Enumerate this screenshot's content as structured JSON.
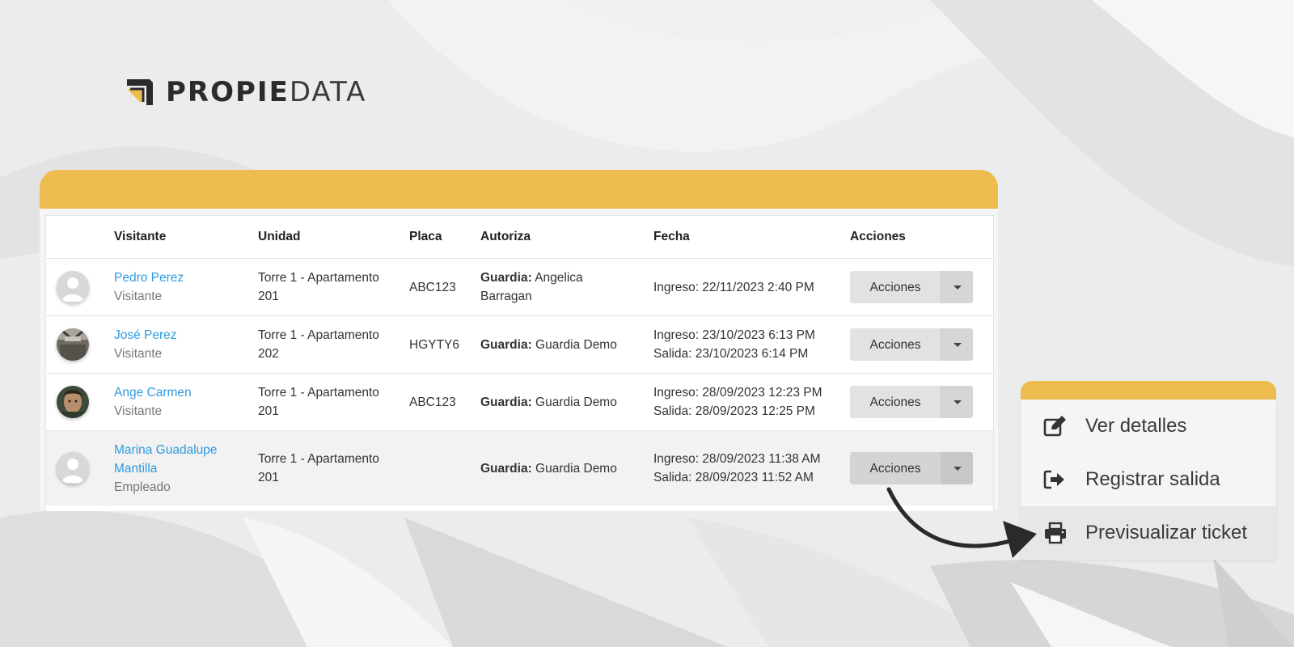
{
  "brand": {
    "name_bold": "PROPIE",
    "name_light": "DATA",
    "accent": "#ecbc4e"
  },
  "table": {
    "headers": {
      "visitante": "Visitante",
      "unidad": "Unidad",
      "placa": "Placa",
      "autoriza": "Autoriza",
      "fecha": "Fecha",
      "acciones": "Acciones"
    },
    "rows": [
      {
        "name": "Pedro Perez",
        "type": "Visitante",
        "unit_line1": "Torre 1 - Apartamento",
        "unit_line2": "201",
        "placa": "ABC123",
        "auth_label": "Guardia:",
        "auth_value_1": "Angelica",
        "auth_value_2": "Barragan",
        "ingreso": "Ingreso: 22/11/2023 2:40 PM",
        "salida": "",
        "action": "Acciones",
        "avatar": "default-avatar-icon"
      },
      {
        "name": "José Perez",
        "type": "Visitante",
        "unit_line1": "Torre 1 - Apartamento",
        "unit_line2": "202",
        "placa": "HGYTY6",
        "auth_label": "Guardia:",
        "auth_value": "Guardia Demo",
        "ingreso": "Ingreso: 23/10/2023 6:13 PM",
        "salida": "Salida: 23/10/2023 6:14 PM",
        "action": "Acciones",
        "avatar": "photo-avatar"
      },
      {
        "name": "Ange Carmen",
        "type": "Visitante",
        "unit_line1": "Torre 1 - Apartamento",
        "unit_line2": "201",
        "placa": "ABC123",
        "auth_label": "Guardia:",
        "auth_value": "Guardia Demo",
        "ingreso": "Ingreso: 28/09/2023 12:23 PM",
        "salida": "Salida: 28/09/2023 12:25 PM",
        "action": "Acciones",
        "avatar": "photo-avatar"
      },
      {
        "name_line1": "Marina Guadalupe",
        "name_line2": "Mantilla",
        "type": "Empleado",
        "unit_line1": "Torre 1 - Apartamento",
        "unit_line2": "201",
        "placa": "",
        "auth_label": "Guardia:",
        "auth_value": "Guardia Demo",
        "ingreso": "Ingreso: 28/09/2023 11:38 AM",
        "salida": "Salida: 28/09/2023 11:52 AM",
        "action": "Acciones",
        "avatar": "default-avatar-icon"
      }
    ]
  },
  "menu": {
    "items": [
      {
        "label": "Ver detalles",
        "icon": "edit-icon"
      },
      {
        "label": "Registrar salida",
        "icon": "sign-out-icon"
      },
      {
        "label": "Previsualizar ticket",
        "icon": "print-icon",
        "active": true
      }
    ]
  },
  "colors": {
    "link": "#2d9be0",
    "header_bar": "#ecbc4e"
  }
}
